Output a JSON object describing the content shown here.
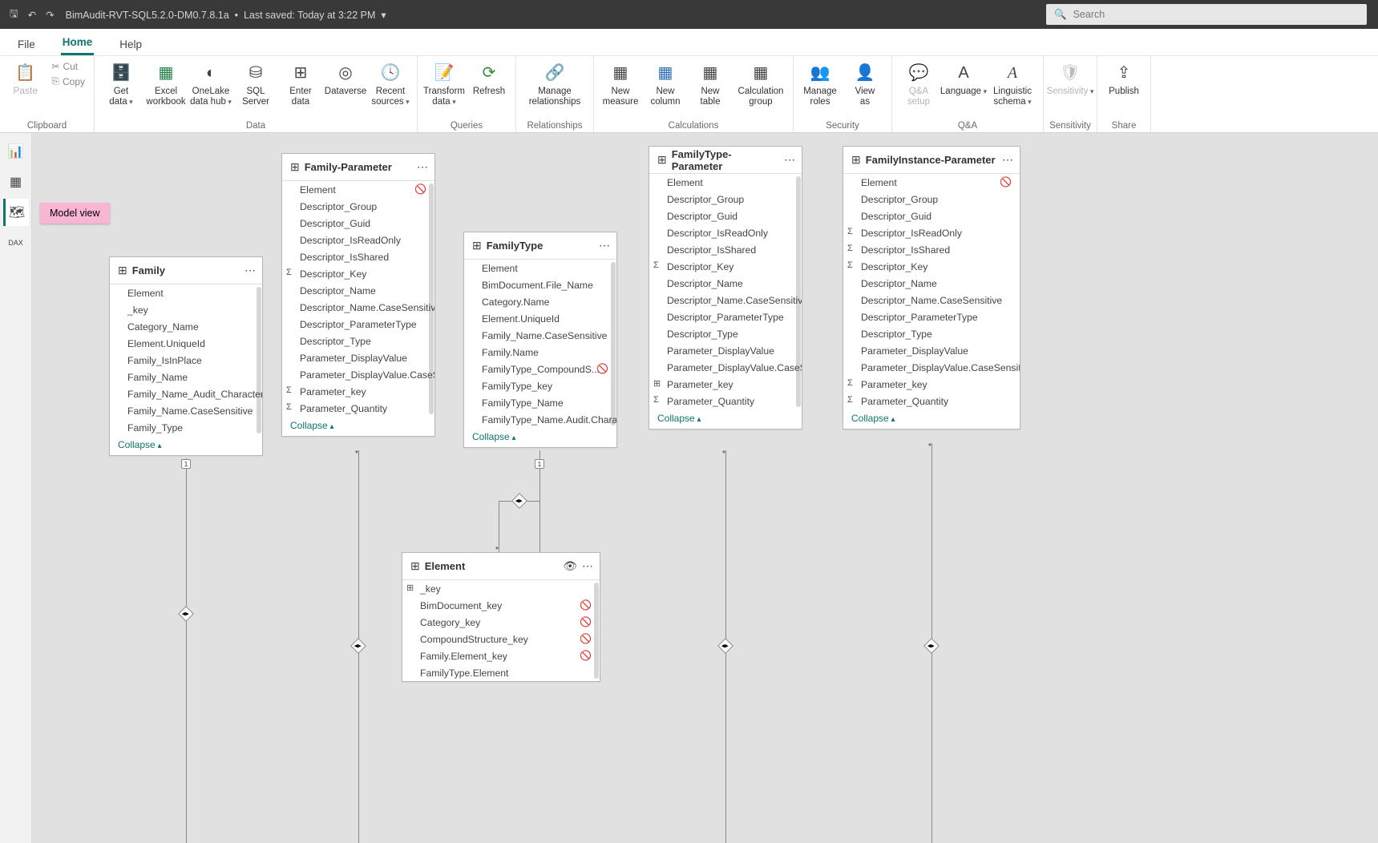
{
  "title": {
    "doc": "BimAudit-RVT-SQL5.2.0-DM0.7.8.1a",
    "saved": "Last saved: Today at 3:22 PM",
    "search_placeholder": "Search"
  },
  "tabs": {
    "file": "File",
    "home": "Home",
    "help": "Help"
  },
  "ribbon": {
    "clipboard": {
      "paste": "Paste",
      "cut": "Cut",
      "copy": "Copy",
      "label": "Clipboard"
    },
    "data": {
      "get": "Get\ndata",
      "excel": "Excel\nworkbook",
      "onelake": "OneLake\ndata hub",
      "sql": "SQL\nServer",
      "enter": "Enter\ndata",
      "dataverse": "Dataverse",
      "recent": "Recent\nsources",
      "label": "Data"
    },
    "queries": {
      "transform": "Transform\ndata",
      "refresh": "Refresh",
      "label": "Queries"
    },
    "rel": {
      "manage": "Manage\nrelationships",
      "label": "Relationships"
    },
    "calc": {
      "measure": "New\nmeasure",
      "column": "New\ncolumn",
      "table": "New\ntable",
      "group": "Calculation\ngroup",
      "label": "Calculations"
    },
    "sec": {
      "roles": "Manage\nroles",
      "viewas": "View\nas",
      "label": "Security"
    },
    "qa": {
      "setup": "Q&A\nsetup",
      "lang": "Language",
      "schema": "Linguistic\nschema",
      "label": "Q&A"
    },
    "sens": {
      "btn": "Sensitivity",
      "label": "Sensitivity"
    },
    "share": {
      "pub": "Publish",
      "label": "Share"
    }
  },
  "tooltip": "Model view",
  "tables": {
    "family": {
      "title": "Family",
      "fields": [
        {
          "n": "Element"
        },
        {
          "n": "_key"
        },
        {
          "n": "Category_Name"
        },
        {
          "n": "Element.UniqueId"
        },
        {
          "n": "Family_IsInPlace"
        },
        {
          "n": "Family_Name"
        },
        {
          "n": "Family_Name_Audit_Character"
        },
        {
          "n": "Family_Name.CaseSensitive"
        },
        {
          "n": "Family_Type"
        }
      ]
    },
    "familyParam": {
      "title": "Family-Parameter",
      "fields": [
        {
          "n": "Element",
          "r": "hide"
        },
        {
          "n": "Descriptor_Group"
        },
        {
          "n": "Descriptor_Guid"
        },
        {
          "n": "Descriptor_IsReadOnly"
        },
        {
          "n": "Descriptor_IsShared"
        },
        {
          "n": "Descriptor_Key",
          "s": "Σ"
        },
        {
          "n": "Descriptor_Name"
        },
        {
          "n": "Descriptor_Name.CaseSensitive"
        },
        {
          "n": "Descriptor_ParameterType"
        },
        {
          "n": "Descriptor_Type"
        },
        {
          "n": "Parameter_DisplayValue"
        },
        {
          "n": "Parameter_DisplayValue.CaseSens..."
        },
        {
          "n": "Parameter_key",
          "s": "Σ"
        },
        {
          "n": "Parameter_Quantity",
          "s": "Σ"
        }
      ]
    },
    "familyType": {
      "title": "FamilyType",
      "fields": [
        {
          "n": "Element"
        },
        {
          "n": "BimDocument.File_Name"
        },
        {
          "n": "Category.Name"
        },
        {
          "n": "Element.UniqueId"
        },
        {
          "n": "Family_Name.CaseSensitive"
        },
        {
          "n": "Family.Name"
        },
        {
          "n": "FamilyType_CompoundS...",
          "r": "hide"
        },
        {
          "n": "FamilyType_key"
        },
        {
          "n": "FamilyType_Name"
        },
        {
          "n": "FamilyType_Name.Audit.Character"
        }
      ]
    },
    "ftParam": {
      "title": "FamilyType-Parameter",
      "fields": [
        {
          "n": "Element"
        },
        {
          "n": "Descriptor_Group"
        },
        {
          "n": "Descriptor_Guid"
        },
        {
          "n": "Descriptor_IsReadOnly"
        },
        {
          "n": "Descriptor_IsShared"
        },
        {
          "n": "Descriptor_Key",
          "s": "Σ"
        },
        {
          "n": "Descriptor_Name"
        },
        {
          "n": "Descriptor_Name.CaseSensitive"
        },
        {
          "n": "Descriptor_ParameterType"
        },
        {
          "n": "Descriptor_Type"
        },
        {
          "n": "Parameter_DisplayValue"
        },
        {
          "n": "Parameter_DisplayValue.CaseSens..."
        },
        {
          "n": "Parameter_key",
          "s": "⊞"
        },
        {
          "n": "Parameter_Quantity",
          "s": "Σ"
        }
      ]
    },
    "fiParam": {
      "title": "FamilyInstance-Parameter",
      "fields": [
        {
          "n": "Element",
          "r": "hide"
        },
        {
          "n": "Descriptor_Group"
        },
        {
          "n": "Descriptor_Guid"
        },
        {
          "n": "Descriptor_IsReadOnly",
          "s": "Σ"
        },
        {
          "n": "Descriptor_IsShared",
          "s": "Σ"
        },
        {
          "n": "Descriptor_Key",
          "s": "Σ"
        },
        {
          "n": "Descriptor_Name"
        },
        {
          "n": "Descriptor_Name.CaseSensitive"
        },
        {
          "n": "Descriptor_ParameterType"
        },
        {
          "n": "Descriptor_Type"
        },
        {
          "n": "Parameter_DisplayValue"
        },
        {
          "n": "Parameter_DisplayValue.CaseSensitive"
        },
        {
          "n": "Parameter_key",
          "s": "Σ"
        },
        {
          "n": "Parameter_Quantity",
          "s": "Σ"
        }
      ]
    },
    "element": {
      "title": "Element",
      "fields": [
        {
          "n": "_key",
          "s": "⊞"
        },
        {
          "n": "BimDocument_key",
          "r": "hide"
        },
        {
          "n": "Category_key",
          "r": "hide"
        },
        {
          "n": "CompoundStructure_key",
          "r": "hide"
        },
        {
          "n": "Family.Element_key",
          "r": "hide"
        },
        {
          "n": "FamilyType.Element"
        }
      ]
    }
  },
  "collapse_label": "Collapse"
}
